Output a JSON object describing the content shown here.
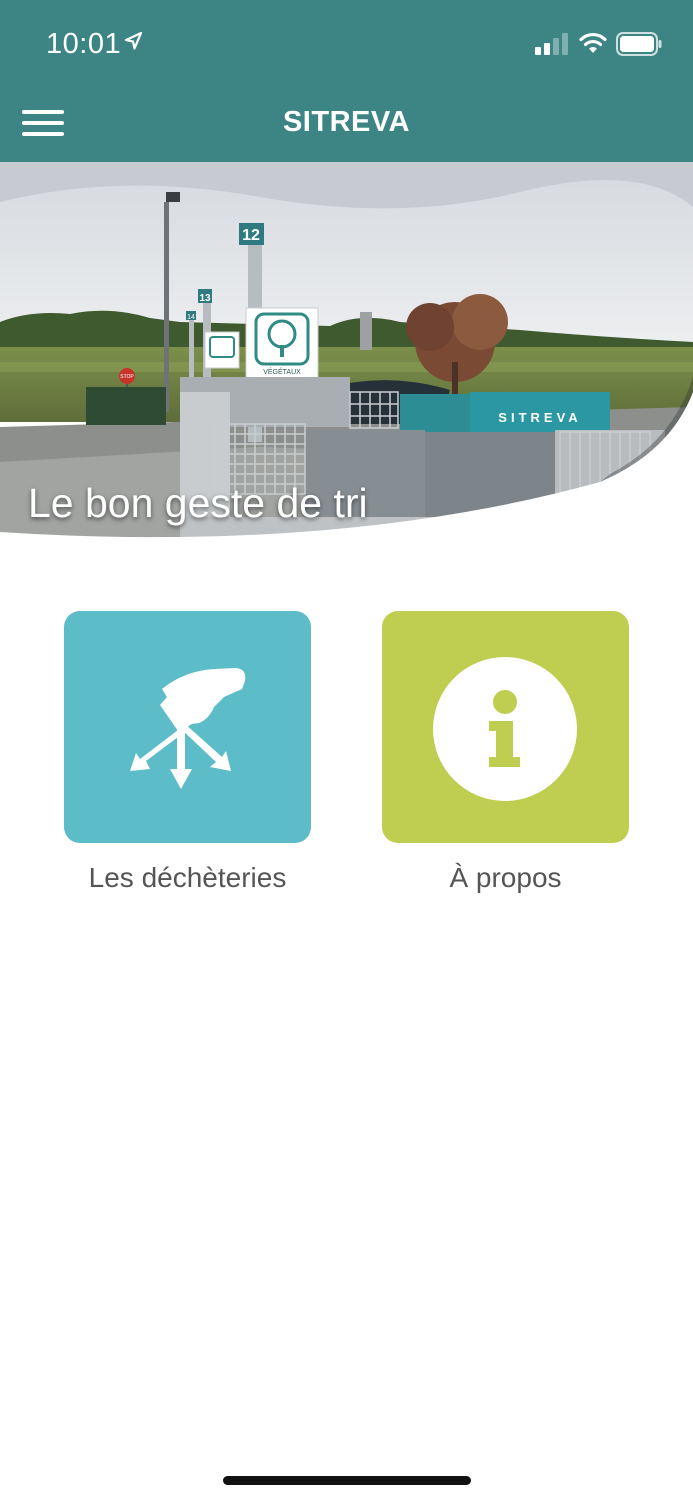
{
  "status_bar": {
    "time": "10:01",
    "icons": [
      "location-arrow-icon",
      "cellular-signal-icon",
      "wifi-icon",
      "battery-icon"
    ]
  },
  "app_bar": {
    "title": "SITREVA",
    "menu_icon": "hamburger-menu-icon",
    "background_color": "#3c8584"
  },
  "hero": {
    "caption": "Le bon geste de tri",
    "sign_numbers": [
      "12",
      "13",
      "14"
    ],
    "sign_label": "VÉGÉTAUX",
    "container_text": "SITREVA",
    "stop_sign": "STOP"
  },
  "tiles": [
    {
      "label": "Les déchèteries",
      "icon": "waste-sorting-hand-icon",
      "color": "#5cbcc8"
    },
    {
      "label": "À propos",
      "icon": "info-icon",
      "color": "#bfcd51"
    }
  ]
}
